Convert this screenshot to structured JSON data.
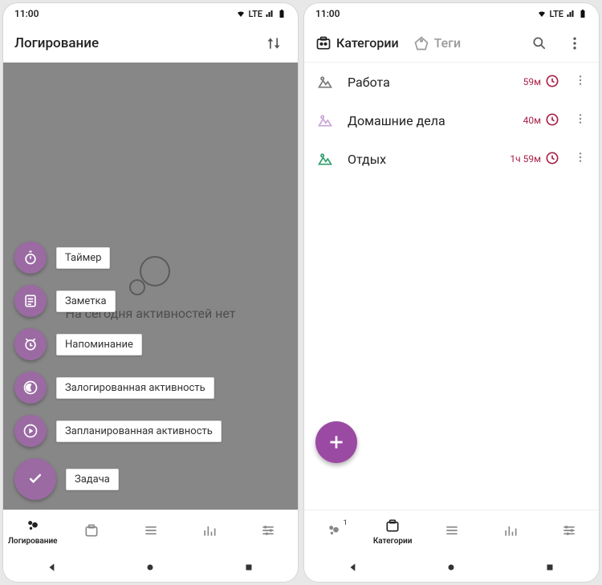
{
  "status": {
    "time": "11:00",
    "net": "LTE"
  },
  "left": {
    "appbar": {
      "title": "Логирование"
    },
    "empty_text": "На сегодня активностей нет",
    "speed_dial": [
      {
        "key": "task",
        "label": "Задача",
        "icon": "check"
      },
      {
        "key": "planned",
        "label": "Запланированная активность",
        "icon": "play-circle"
      },
      {
        "key": "logged",
        "label": "Залогированная активность",
        "icon": "moon-circle"
      },
      {
        "key": "reminder",
        "label": "Напоминание",
        "icon": "alarm"
      },
      {
        "key": "note",
        "label": "Заметка",
        "icon": "note"
      },
      {
        "key": "timer",
        "label": "Таймер",
        "icon": "stopwatch"
      }
    ],
    "nav": {
      "items": [
        {
          "key": "log",
          "label": "Логирование",
          "icon": "dots",
          "active": true
        },
        {
          "key": "cat",
          "label": "",
          "icon": "catbox",
          "active": false
        },
        {
          "key": "list",
          "label": "",
          "icon": "lines",
          "active": false
        },
        {
          "key": "stats",
          "label": "",
          "icon": "bars",
          "active": false
        },
        {
          "key": "set",
          "label": "",
          "icon": "sliders",
          "active": false
        }
      ]
    }
  },
  "right": {
    "tabs": {
      "categories": "Категории",
      "tags": "Теги",
      "active": "categories"
    },
    "categories": [
      {
        "name": "Работа",
        "time": "59м",
        "icon_color": "#777"
      },
      {
        "name": "Домашние дела",
        "time": "40м",
        "icon_color": "#c9a3d6"
      },
      {
        "name": "Отдых",
        "time": "1ч 59м",
        "icon_color": "#2e9e6b"
      }
    ],
    "nav": {
      "items": [
        {
          "key": "log",
          "label": "",
          "icon": "dots",
          "active": false,
          "badge": "1"
        },
        {
          "key": "cat",
          "label": "Категории",
          "icon": "catbox",
          "active": true
        },
        {
          "key": "list",
          "label": "",
          "icon": "lines",
          "active": false
        },
        {
          "key": "stats",
          "label": "",
          "icon": "bars",
          "active": false
        },
        {
          "key": "set",
          "label": "",
          "icon": "sliders",
          "active": false
        }
      ]
    }
  },
  "colors": {
    "accent": "#9b4aa3",
    "accent_light": "#9b6aa3",
    "time": "#a82048"
  }
}
